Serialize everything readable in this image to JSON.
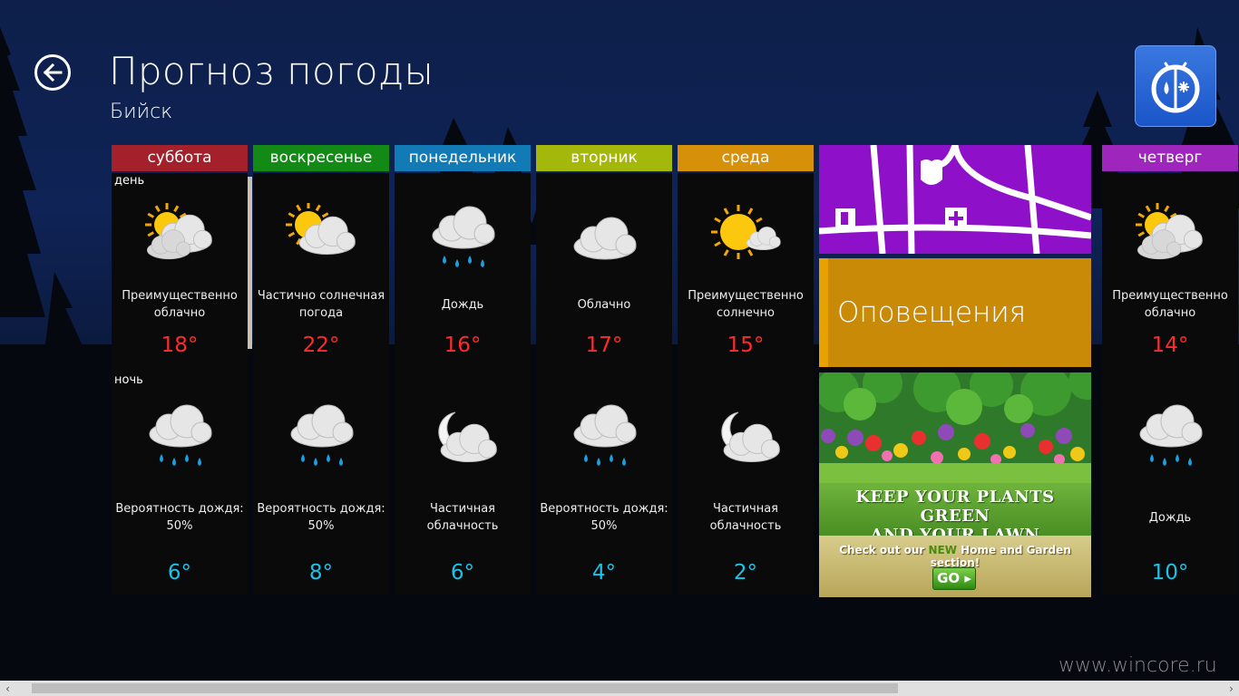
{
  "header": {
    "title": "Прогноз погоды",
    "city": "Бийск"
  },
  "labels": {
    "day": "день",
    "night": "ночь"
  },
  "days": [
    {
      "name": "суббота",
      "color": "#a4202a",
      "day": {
        "icon": "mostly-cloudy-icon",
        "desc": [
          "Преимущественно",
          "облачно"
        ],
        "temp": "18°"
      },
      "night": {
        "icon": "rain-icon",
        "desc": [
          "Вероятность дождя:",
          "50%"
        ],
        "temp": "6°"
      }
    },
    {
      "name": "воскресенье",
      "color": "#138a16",
      "day": {
        "icon": "partly-sunny-icon",
        "desc": [
          "Частично солнечная",
          "погода"
        ],
        "temp": "22°"
      },
      "night": {
        "icon": "rain-icon",
        "desc": [
          "Вероятность дождя:",
          "50%"
        ],
        "temp": "8°"
      }
    },
    {
      "name": "понедельник",
      "color": "#127ab4",
      "day": {
        "icon": "rain-icon",
        "desc": [
          "Дождь"
        ],
        "temp": "16°"
      },
      "night": {
        "icon": "moon-cloud-icon",
        "desc": [
          "Частичная",
          "облачность"
        ],
        "temp": "6°"
      }
    },
    {
      "name": "вторник",
      "color": "#a4b80c",
      "day": {
        "icon": "cloudy-icon",
        "desc": [
          "Облачно"
        ],
        "temp": "17°"
      },
      "night": {
        "icon": "rain-icon",
        "desc": [
          "Вероятность дождя:",
          "50%"
        ],
        "temp": "4°"
      }
    },
    {
      "name": "среда",
      "color": "#d6900a",
      "day": {
        "icon": "mostly-sunny-icon",
        "desc": [
          "Преимущественно",
          "солнечно"
        ],
        "temp": "15°"
      },
      "night": {
        "icon": "moon-cloud-icon",
        "desc": [
          "Частичная",
          "облачность"
        ],
        "temp": "2°"
      }
    },
    {
      "name": "четверг",
      "color": "#9e26bc",
      "day": {
        "icon": "mostly-cloudy-icon",
        "desc": [
          "Преимущественно",
          "облачно"
        ],
        "temp": "14°"
      },
      "night": {
        "icon": "rain-icon",
        "desc": [
          "Дождь"
        ],
        "temp": "10°"
      }
    }
  ],
  "tiles": {
    "map": {
      "icon": "map-icon"
    },
    "alerts": {
      "label": "Оповещения"
    },
    "ad": {
      "line1": "KEEP YOUR PLANTS GREEN",
      "line2": "AND YOUR LAWN PRISTINE.",
      "sub_before": "Check out our ",
      "sub_new": "NEW",
      "sub_after": " Home and Garden section!",
      "go": "GO"
    }
  },
  "watermark": "www.wincore.ru",
  "scrollbar": {
    "position": 0.7
  }
}
